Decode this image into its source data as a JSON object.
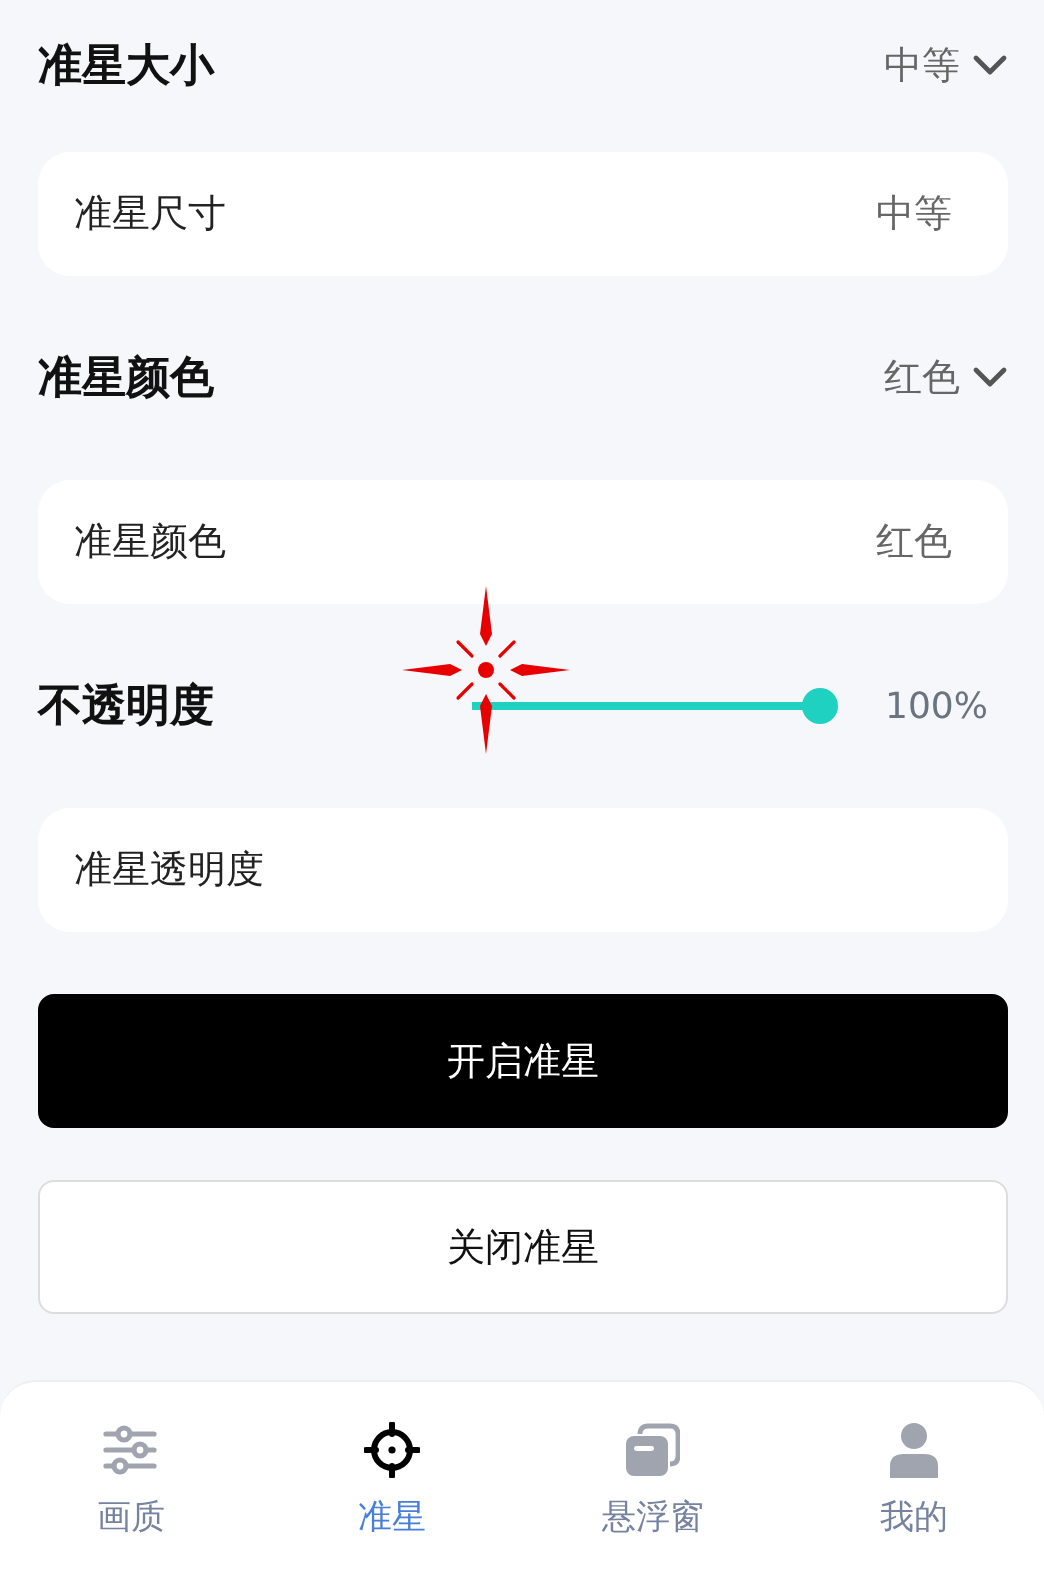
{
  "sections": [
    {
      "kind": "dropdown",
      "title": "准星大小",
      "value": "中等",
      "row": {
        "label": "准星尺寸",
        "value": "中等"
      }
    },
    {
      "kind": "dropdown",
      "title": "准星颜色",
      "value": "红色",
      "row": {
        "label": "准星颜色",
        "value": "红色"
      }
    },
    {
      "kind": "slider",
      "title": "不透明度",
      "level": 1,
      "reading": "100%",
      "row": {
        "label": "准星透明度"
      }
    }
  ],
  "buttons": [
    {
      "label": "开启准星",
      "kind": "primary"
    },
    {
      "label": "关闭准星",
      "kind": "secondary"
    }
  ],
  "nav": [
    {
      "label": "画质",
      "kind": "sliders",
      "selected": false
    },
    {
      "label": "准星",
      "kind": "crosshair",
      "selected": true
    },
    {
      "label": "悬浮窗",
      "kind": "windows",
      "selected": false
    },
    {
      "label": "我的",
      "kind": "person",
      "selected": false
    }
  ]
}
